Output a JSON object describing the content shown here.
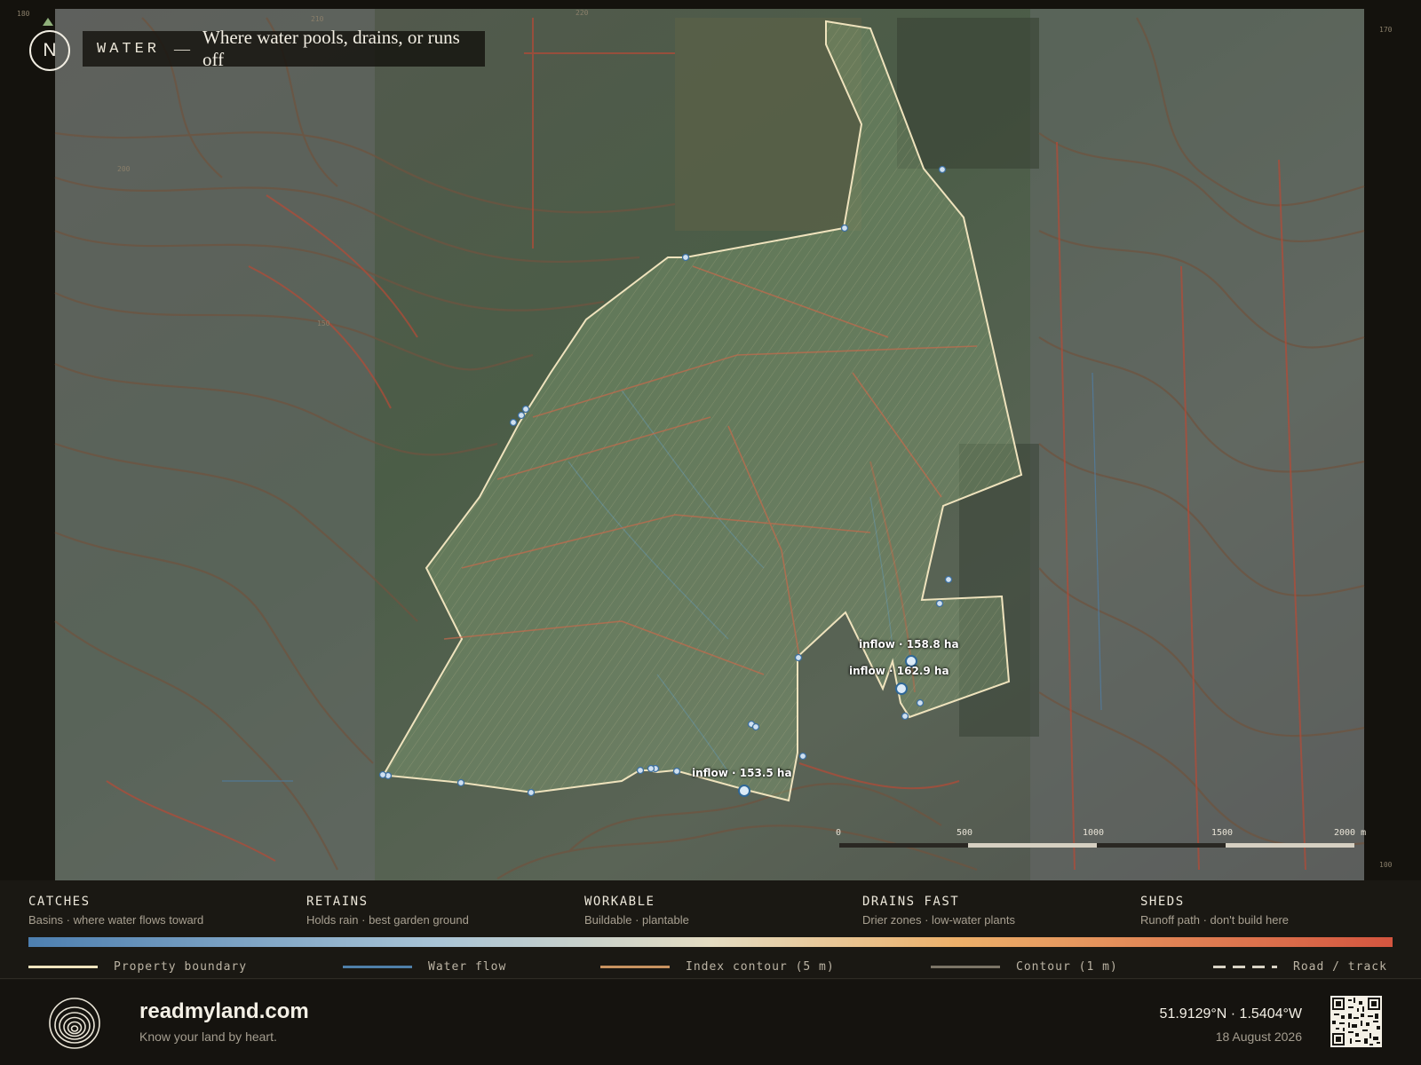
{
  "map": {
    "layer_name": "WATER",
    "dash": "—",
    "layer_description": "Where water pools, drains, or runs off",
    "north_label": "N",
    "edge_ticks": [
      "180",
      "210",
      "220",
      "200",
      "150",
      "170",
      "100"
    ],
    "inflows": [
      {
        "label": "inflow · 158.8 ha",
        "area_ha": 158.8
      },
      {
        "label": "inflow · 162.9 ha",
        "area_ha": 162.9
      },
      {
        "label": "inflow · 153.5 ha",
        "area_ha": 153.5
      }
    ],
    "scale_bar": {
      "labels": [
        "0",
        "500",
        "1000",
        "1500",
        "2000 m"
      ],
      "unit": "m"
    }
  },
  "legend": {
    "categories": [
      {
        "name": "CATCHES",
        "description": "Basins · where water flows toward"
      },
      {
        "name": "RETAINS",
        "description": "Holds rain · best garden ground"
      },
      {
        "name": "WORKABLE",
        "description": "Buildable · plantable"
      },
      {
        "name": "DRAINS FAST",
        "description": "Drier zones · low-water plants"
      },
      {
        "name": "SHEDS",
        "description": "Runoff path · don't build here"
      }
    ],
    "gradient_colors": [
      "#4d7fb0",
      "#a9c4d6",
      "#e4dcc2",
      "#ecb06a",
      "#d4553f"
    ],
    "keys": [
      {
        "label": "Property boundary",
        "color": "#efe3bd"
      },
      {
        "label": "Water flow",
        "color": "#4f7fa8"
      },
      {
        "label": "Index contour (5 m)",
        "color": "#c89260"
      },
      {
        "label": "Contour (1 m)",
        "color": "#7b7466"
      },
      {
        "label": "Road / track",
        "color": "#d8d2c4"
      }
    ]
  },
  "footer": {
    "brand": "readmyland.com",
    "tagline": "Know your land by heart.",
    "coordinates": "51.9129°N · 1.5404°W",
    "date": "18 August 2026"
  }
}
